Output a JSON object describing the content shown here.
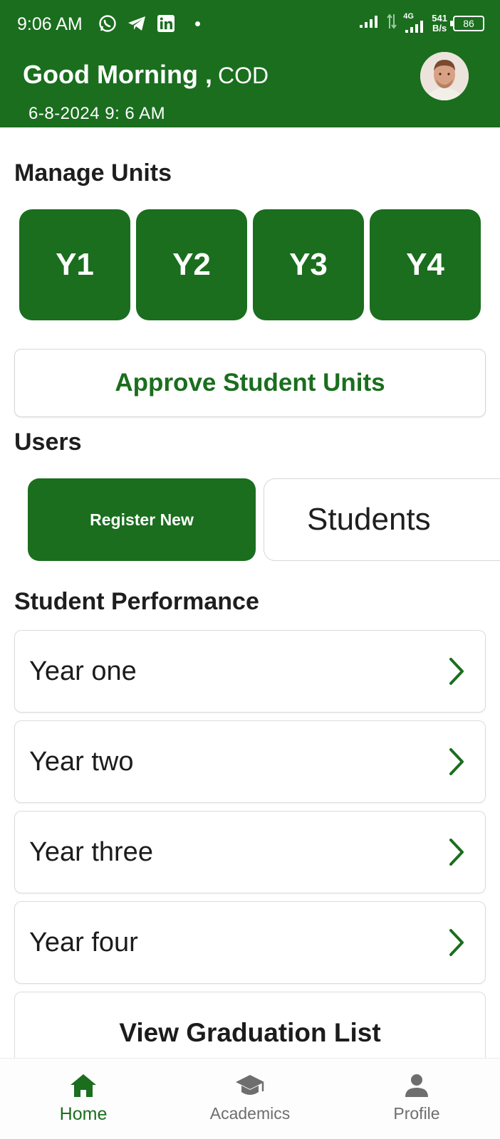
{
  "status_bar": {
    "time": "9:06 AM",
    "net_speed_value": "541",
    "net_speed_unit": "B/s",
    "network_type": "4G",
    "battery": "86"
  },
  "header": {
    "greeting": "Good Morning ,",
    "user": "COD",
    "datetime": "6-8-2024  9: 6 AM"
  },
  "manage_units": {
    "title": "Manage Units",
    "years": [
      "Y1",
      "Y2",
      "Y3",
      "Y4"
    ],
    "approve_label": "Approve Student Units"
  },
  "users": {
    "title": "Users",
    "register_label": "Register New",
    "students_label": "Students"
  },
  "performance": {
    "title": "Student Performance",
    "items": [
      "Year one",
      "Year two",
      "Year three",
      "Year four"
    ],
    "graduation_label": "View Graduation List"
  },
  "nav": {
    "items": [
      {
        "label": "Home",
        "icon": "home-icon",
        "active": true
      },
      {
        "label": "Academics",
        "icon": "graduation-cap-icon",
        "active": false
      },
      {
        "label": "Profile",
        "icon": "person-icon",
        "active": false
      }
    ]
  },
  "colors": {
    "primary": "#1a6e1e",
    "nav_inactive": "#6e6e6e"
  }
}
